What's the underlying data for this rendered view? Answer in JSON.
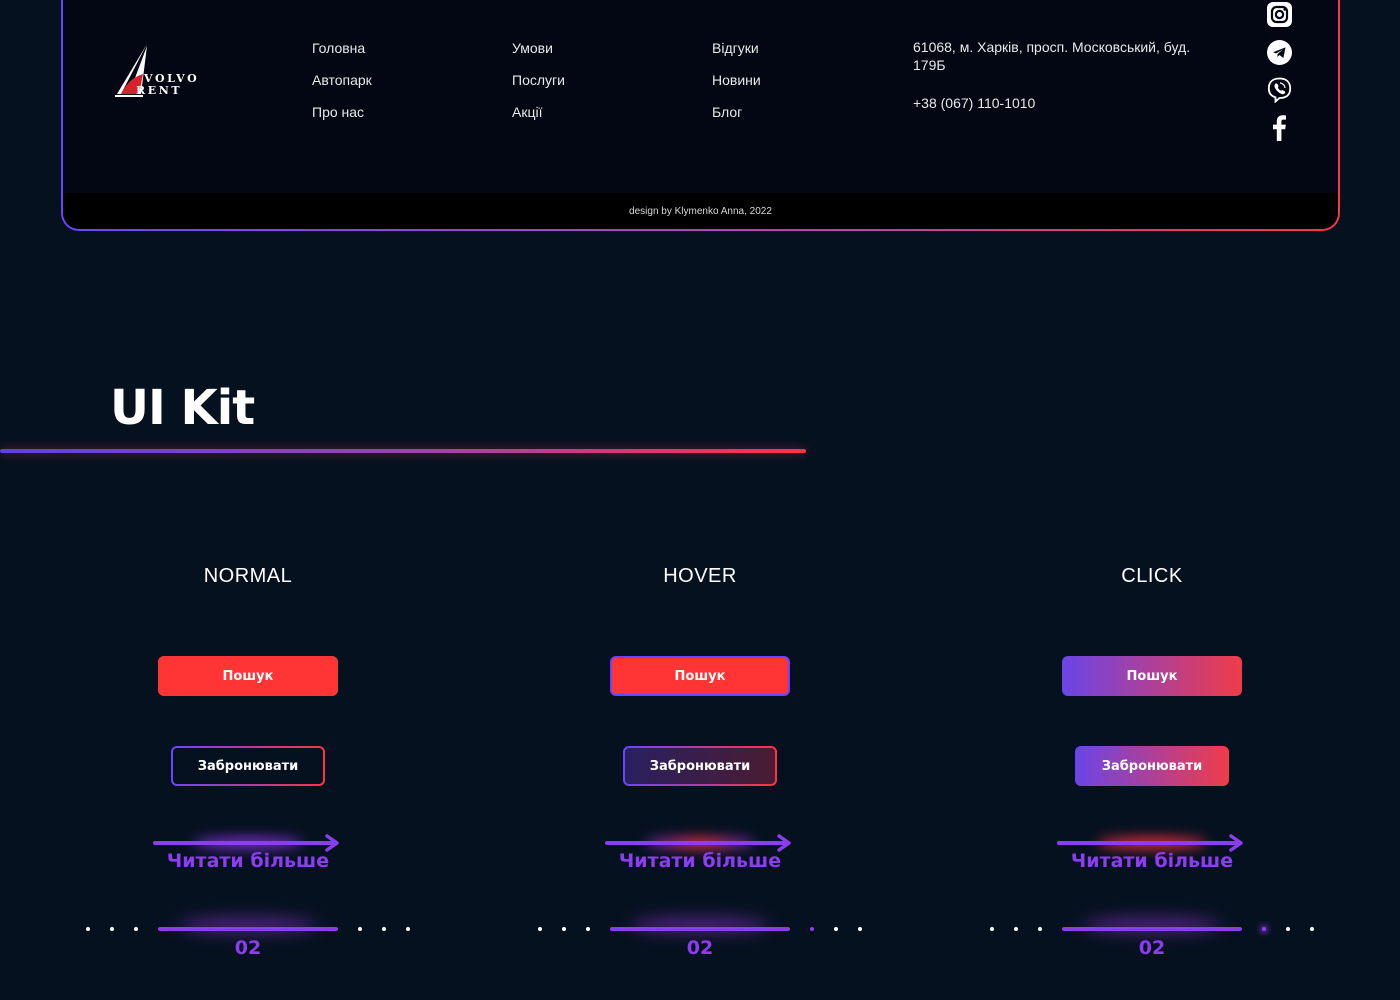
{
  "footer": {
    "logo": {
      "line1": "VOLVO",
      "line2": "RENT"
    },
    "nav": [
      [
        "Головна",
        "Автопарк",
        "Про нас"
      ],
      [
        "Умови",
        "Послуги",
        "Акції"
      ],
      [
        "Відгуки",
        "Новини",
        "Блог"
      ]
    ],
    "address": "61068, м. Харків, просп. Московський, буд. 179Б",
    "phone": "+38 (067) 110-1010",
    "socials": [
      "instagram-icon",
      "telegram-icon",
      "viber-icon",
      "facebook-icon"
    ],
    "copyright": "design by Klymenko Anna, 2022"
  },
  "uikit": {
    "title": "UI Kit",
    "states": [
      {
        "key": "normal",
        "label": "NORMAL"
      },
      {
        "key": "hover",
        "label": "HOVER"
      },
      {
        "key": "click",
        "label": "CLICK"
      }
    ],
    "search_label": "Пошук",
    "book_label": "Забронювати",
    "readmore_label": "Читати більше",
    "slide_number": "02"
  },
  "colors": {
    "accent_red": "#ff3535",
    "accent_purple": "#8d3df0",
    "gradient_start": "#6a45ff",
    "gradient_end": "#ff3344",
    "background": "#061120"
  }
}
